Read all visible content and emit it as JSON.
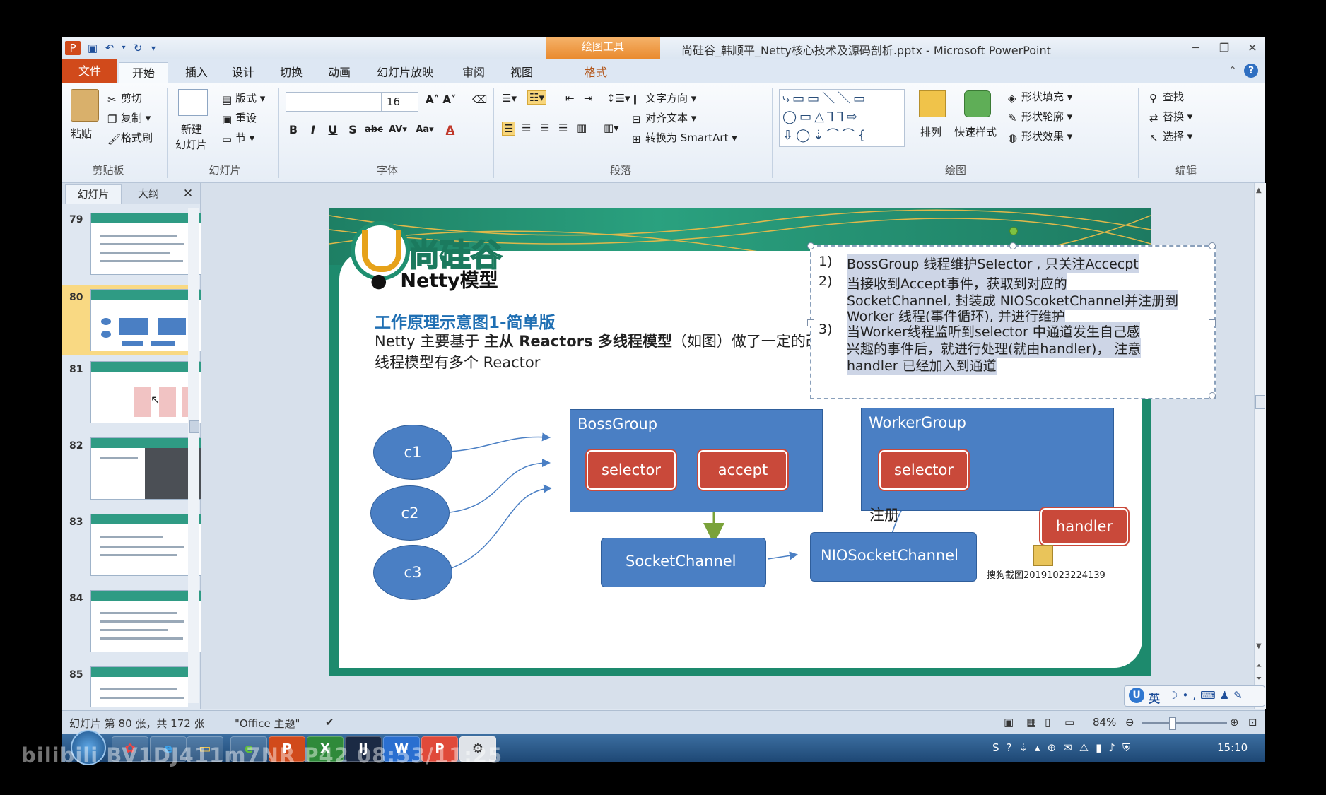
{
  "app": {
    "context_tab_group": "绘图工具",
    "window_title": "尚硅谷_韩顺平_Netty核心技术及源码剖析.pptx - Microsoft PowerPoint",
    "tabs": [
      "文件",
      "开始",
      "插入",
      "设计",
      "切换",
      "动画",
      "幻灯片放映",
      "审阅",
      "视图",
      "格式"
    ]
  },
  "ribbon": {
    "clipboard": {
      "paste": "粘贴",
      "cut": "剪切",
      "copy": "复制",
      "format_painter": "格式刷",
      "label": "剪贴板"
    },
    "slides": {
      "new_slide": "新建",
      "new_slide2": "幻灯片",
      "layout": "版式",
      "reset": "重设",
      "section": "节",
      "label": "幻灯片"
    },
    "font": {
      "size": "16",
      "label": "字体"
    },
    "paragraph": {
      "text_direction": "文字方向",
      "align_text": "对齐文本",
      "smartart": "转换为 SmartArt",
      "label": "段落"
    },
    "drawing": {
      "arrange": "排列",
      "quick_styles": "快速样式",
      "shape_fill": "形状填充",
      "shape_outline": "形状轮廓",
      "shape_effects": "形状效果",
      "label": "绘图"
    },
    "editing": {
      "find": "查找",
      "replace": "替换",
      "select": "选择",
      "label": "编辑"
    }
  },
  "panel": {
    "tab_slides": "幻灯片",
    "tab_outline": "大纲",
    "thumbnails": [
      "79",
      "80",
      "81",
      "82",
      "83",
      "84",
      "85"
    ],
    "selected": "80"
  },
  "slide": {
    "logo_text": "尚硅谷",
    "bullet": "Netty模型",
    "subtitle": "工作原理示意图1-简单版",
    "body_line1_a": "Netty 主要基于",
    "body_line1_b": "主从 Reactors 多线程模型",
    "body_line1_c": "（如图）做了一定的改进，其中主从 Reactor 多",
    "body_line2": "线程模型有多个 Reactor",
    "diagram": {
      "clients": [
        "c1",
        "c2",
        "c3"
      ],
      "boss_group": "BossGroup",
      "boss_selector": "selector",
      "boss_accept": "accept",
      "worker_group": "WorkerGroup",
      "worker_selector": "selector",
      "handler": "handler",
      "socket_channel": "SocketChannel",
      "nio_socket_channel": "NIOSocketChannel",
      "register": "注册"
    },
    "screenshot_file": "搜狗截图20191023224139"
  },
  "callout": {
    "nums": [
      "1)",
      "2)",
      "3)"
    ],
    "lines": [
      "BossGroup 线程维护Selector , 只关注Accecpt",
      "当接收到Accept事件，获取到对应的",
      "SocketChannel, 封装成 NIOScoketChannel并注册到",
      "Worker 线程(事件循环), 并进行维护",
      "当Worker线程监听到selector 中通道发生自己感",
      "兴趣的事件后，就进行处理(就由handler)， 注意",
      "handler 已经加入到通道"
    ]
  },
  "status": {
    "slide_info": "幻灯片 第 80 张，共 172 张",
    "theme": "\"Office 主题\"",
    "zoom": "84%"
  },
  "taskbar": {
    "clock": "15:10",
    "ime": "英"
  },
  "watermark": "bilibili BV1DJ411m7NR P42 08:53/11:25"
}
